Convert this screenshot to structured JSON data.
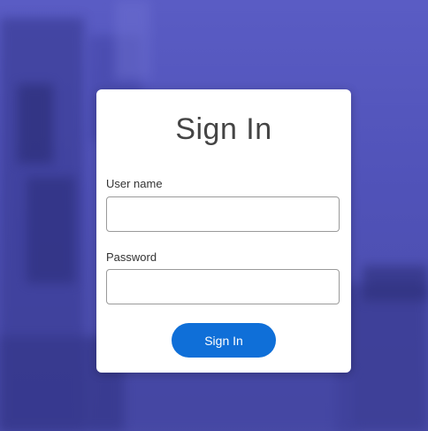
{
  "login": {
    "title": "Sign In",
    "username_label": "User name",
    "username_value": "",
    "password_label": "Password",
    "password_value": "",
    "submit_label": "Sign In"
  },
  "colors": {
    "background": "#5254ba",
    "button": "#0f6fd8",
    "card": "#ffffff"
  }
}
